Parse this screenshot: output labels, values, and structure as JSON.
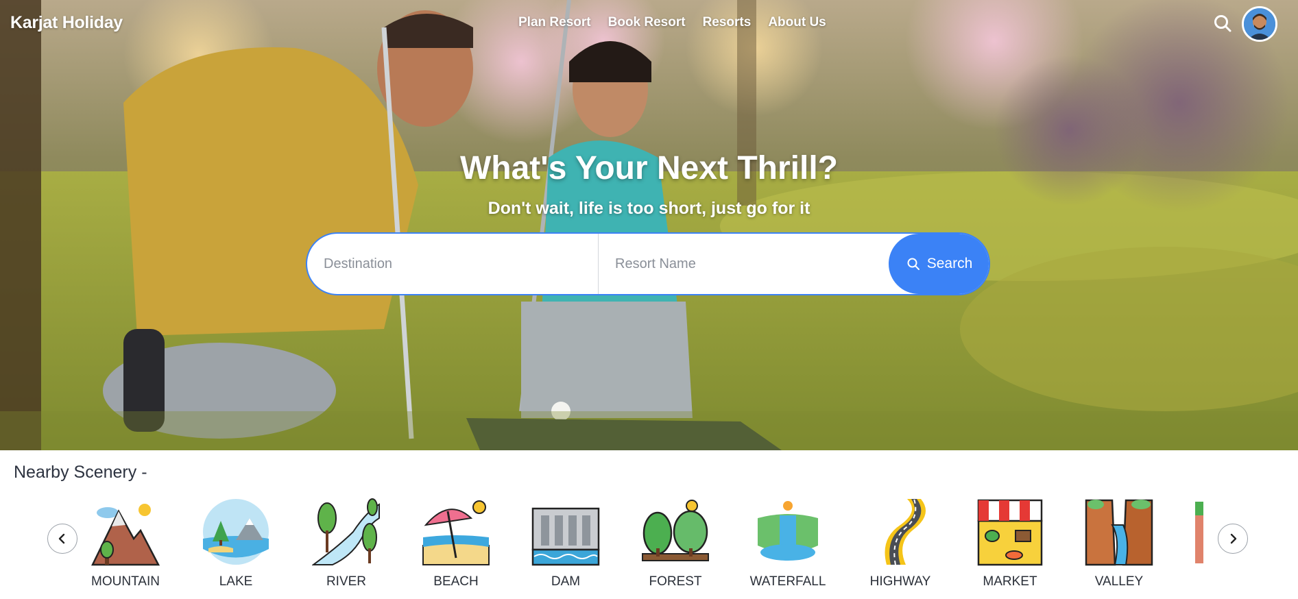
{
  "brand": "Karjat Holiday",
  "nav": {
    "links": [
      "Plan Resort",
      "Book Resort",
      "Resorts",
      "About Us"
    ],
    "search_icon": "search-icon",
    "avatar_icon": "user-avatar"
  },
  "hero": {
    "headline": "What's Your Next Thrill?",
    "subheadline": "Don't wait, life is too short, just go for it"
  },
  "search": {
    "destination_placeholder": "Destination",
    "resort_placeholder": "Resort Name",
    "button_label": "Search",
    "accent_color": "#3b82f6"
  },
  "scenery": {
    "title": "Nearby Scenery -",
    "items": [
      {
        "label": "MOUNTAIN",
        "icon": "mountain-icon"
      },
      {
        "label": "LAKE",
        "icon": "lake-icon"
      },
      {
        "label": "RIVER",
        "icon": "river-icon"
      },
      {
        "label": "BEACH",
        "icon": "beach-icon"
      },
      {
        "label": "DAM",
        "icon": "dam-icon"
      },
      {
        "label": "FOREST",
        "icon": "forest-icon"
      },
      {
        "label": "WATERFALL",
        "icon": "waterfall-icon"
      },
      {
        "label": "HIGHWAY",
        "icon": "highway-icon"
      },
      {
        "label": "MARKET",
        "icon": "market-icon"
      },
      {
        "label": "VALLEY",
        "icon": "valley-icon"
      }
    ],
    "prev_icon": "chevron-left-icon",
    "next_icon": "chevron-right-icon"
  }
}
